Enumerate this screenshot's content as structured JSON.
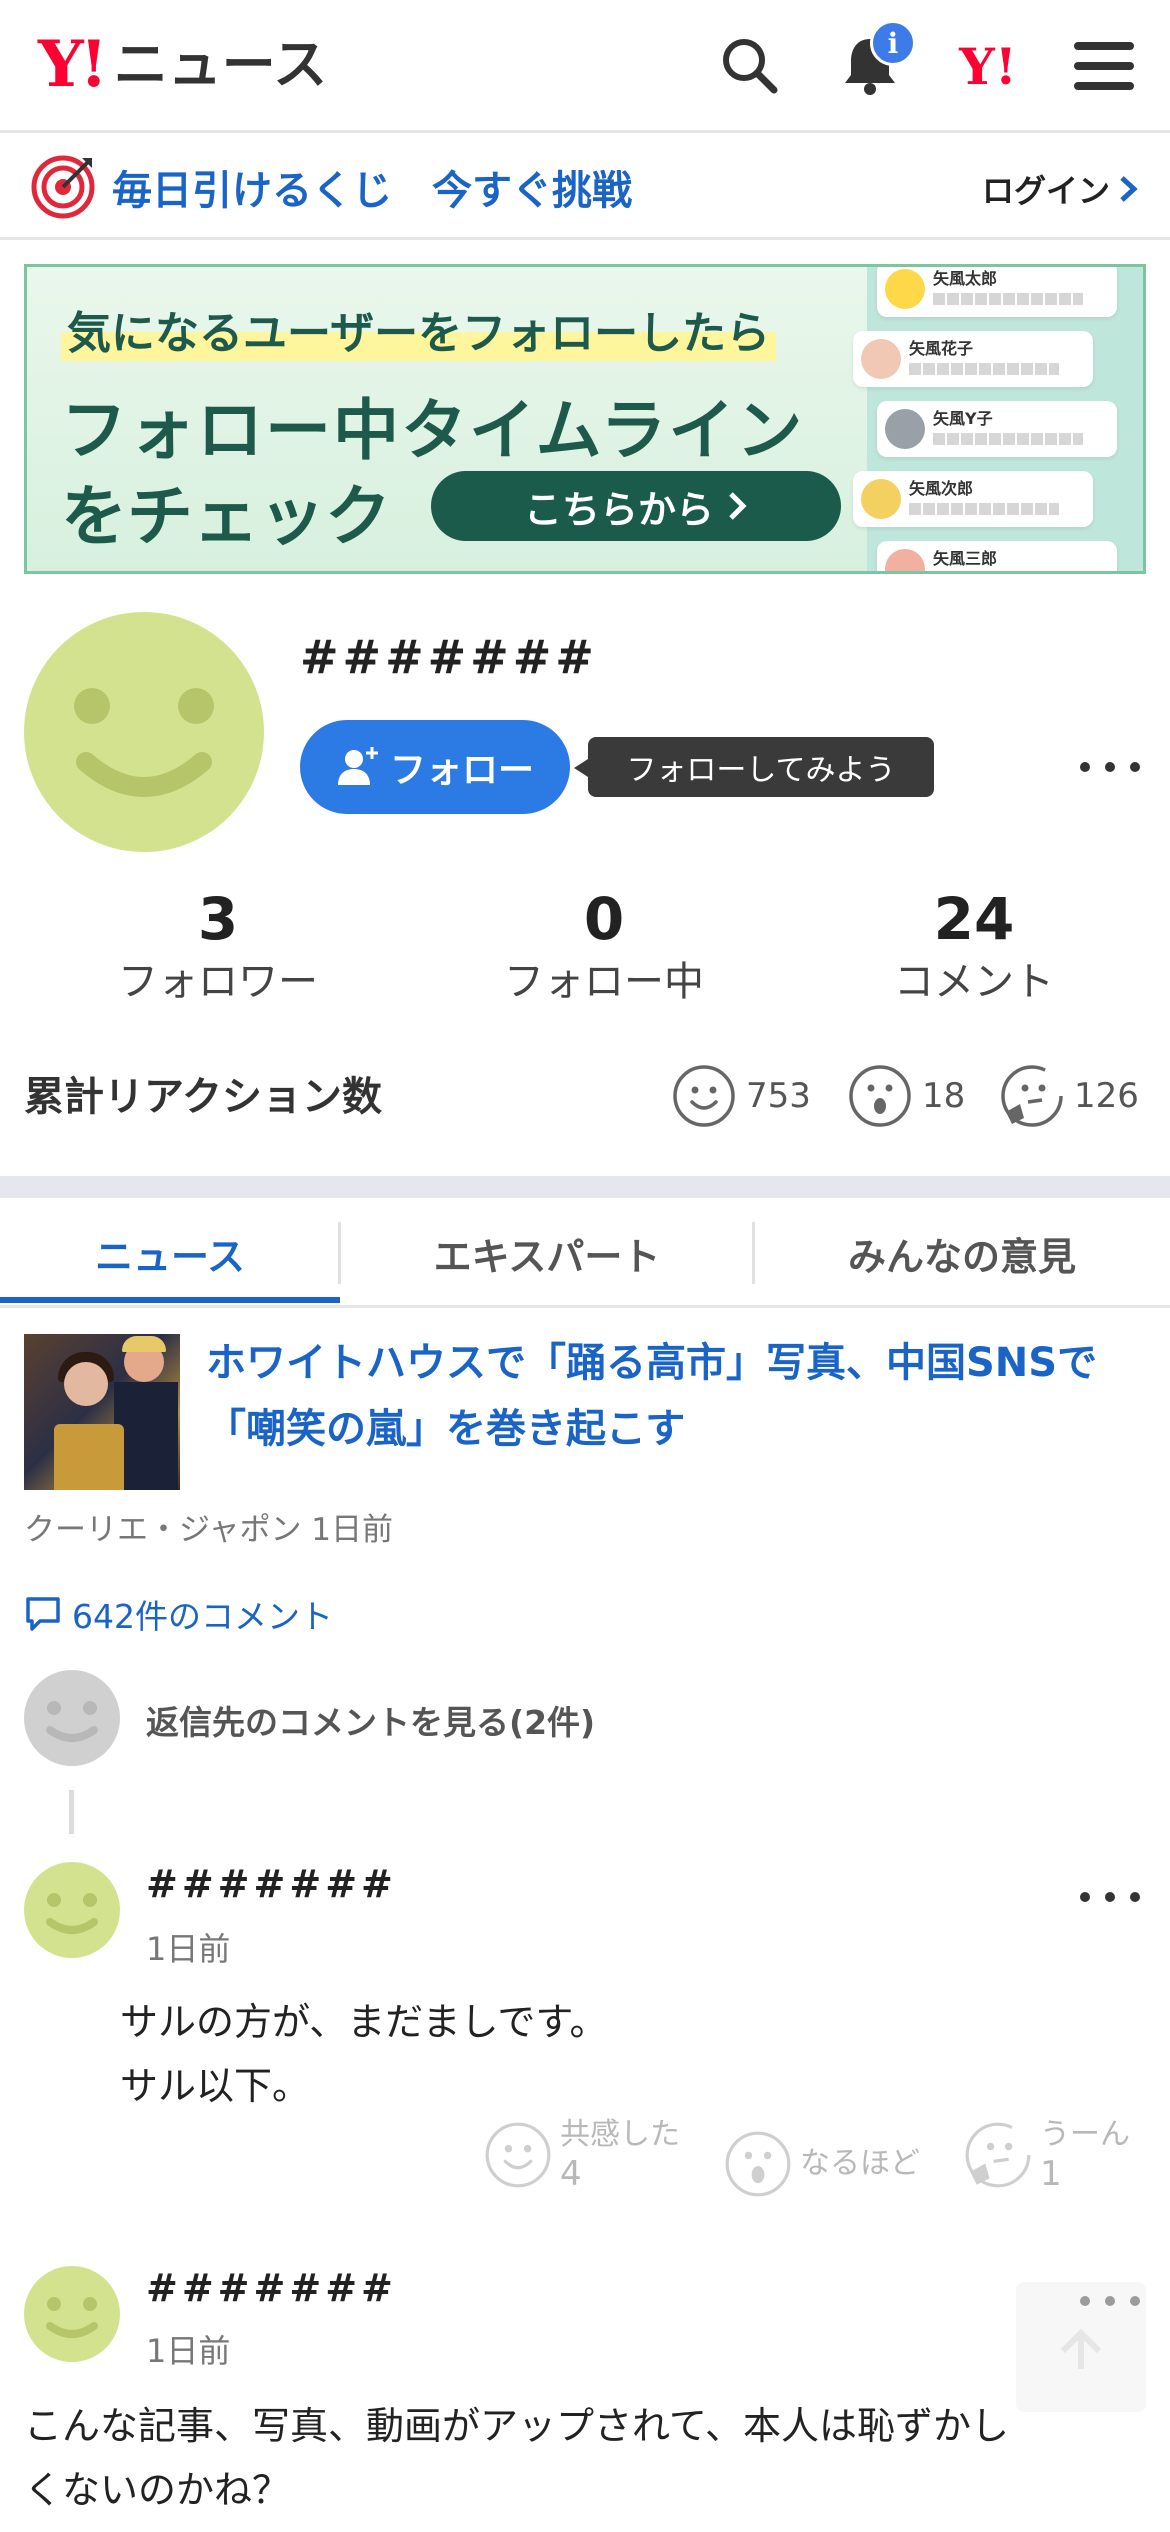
{
  "header": {
    "logo_y": "Y!",
    "logo_news": "ニュース",
    "notification_badge": "i",
    "yahoo_mark": "Y!",
    "icons": [
      "search-icon",
      "bell-icon",
      "yahoo-icon",
      "hamburger-menu-icon"
    ]
  },
  "lottery": {
    "text": "毎日引けるくじ　今すぐ挑戦",
    "login": "ログイン"
  },
  "banner": {
    "line1": "気になるユーザーをフォローしたら",
    "line2": "フォロー中タイムライン",
    "line3": "をチェック",
    "button": "こちらから",
    "cards": [
      {
        "name": "矢風太郎"
      },
      {
        "name": "矢風花子"
      },
      {
        "name": "矢風Y子"
      },
      {
        "name": "矢風次郎"
      },
      {
        "name": "矢風三郎"
      }
    ]
  },
  "profile": {
    "username": "#######",
    "follow_button": "フォロー",
    "tooltip": "フォローしてみよう",
    "stats": [
      {
        "value": "3",
        "label": "フォロワー"
      },
      {
        "value": "0",
        "label": "フォロー中"
      },
      {
        "value": "24",
        "label": "コメント"
      }
    ],
    "reactions_title": "累計リアクション数",
    "reactions": [
      {
        "icon": "smile-icon",
        "count": "753"
      },
      {
        "icon": "surprised-icon",
        "count": "18"
      },
      {
        "icon": "thinking-icon",
        "count": "126"
      }
    ]
  },
  "tabs": [
    {
      "label": "ニュース",
      "active": true
    },
    {
      "label": "エキスパート",
      "active": false
    },
    {
      "label": "みんなの意見",
      "active": false
    }
  ],
  "article": {
    "title": "ホワイトハウスで「踊る高市」写真、中国SNSで「嘲笑の嵐」を巻き起こす",
    "meta": "クーリエ・ジャポン 1日前",
    "comment_count": "642件のコメント",
    "reply_link": "返信先のコメントを見る(2件)"
  },
  "comments": [
    {
      "name": "#######",
      "time": "1日前",
      "lines": [
        "サルの方が、まだましです。",
        "サル以下。"
      ],
      "reactions": [
        {
          "label": "共感した",
          "count": "4"
        },
        {
          "label": "なるほど",
          "count": ""
        },
        {
          "label": "うーん",
          "count": "1"
        }
      ]
    },
    {
      "name": "#######",
      "time": "1日前",
      "lines": [
        "こんな記事、写真、動画がアップされて、本人は恥ずかし",
        "くないのかね？"
      ]
    }
  ],
  "colors": {
    "brand_red": "#ff0033",
    "link_blue": "#1a64c8",
    "follow_blue": "#2c7be5",
    "avatar_green": "#d3e28f"
  }
}
